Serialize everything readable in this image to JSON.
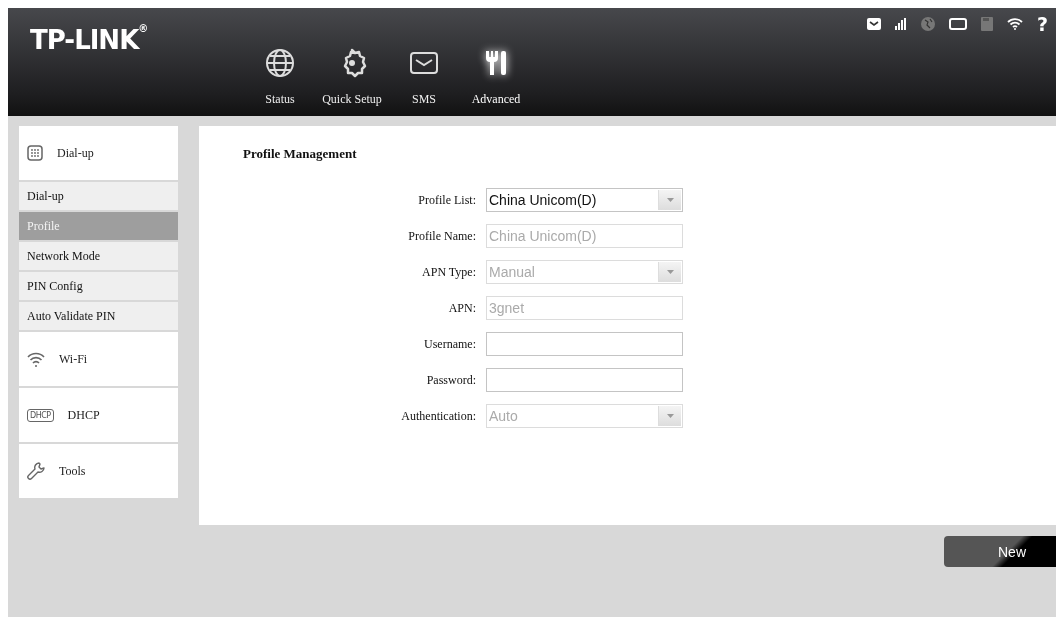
{
  "header": {
    "logo": "TP-LINK$^{®}$",
    "nav": [
      {
        "label": "Status",
        "selected": false
      },
      {
        "label": "Quick Setup",
        "selected": false
      },
      {
        "label": "SMS",
        "selected": false
      },
      {
        "label": "Advanced",
        "selected": true
      }
    ],
    "status_icons": [
      {
        "kind": "message",
        "active": true
      },
      {
        "kind": "signal",
        "active": true
      },
      {
        "kind": "globe",
        "active": false
      },
      {
        "kind": "battery",
        "active": true
      },
      {
        "kind": "sdcard",
        "active": false
      },
      {
        "kind": "wifi",
        "active": true
      },
      {
        "kind": "help",
        "text": "?",
        "active": true
      }
    ]
  },
  "sidebar": {
    "sections": [
      {
        "label": "Dial-up",
        "children": [
          {
            "label": "Dial-up",
            "selected": false
          },
          {
            "label": "Profile",
            "selected": true
          },
          {
            "label": "Network Mode",
            "selected": false
          },
          {
            "label": "PIN Config",
            "selected": false
          },
          {
            "label": "Auto Validate PIN",
            "selected": false
          }
        ]
      },
      {
        "label": "Wi-Fi"
      },
      {
        "label": "DHCP",
        "badge": "DHCP"
      },
      {
        "label": "Tools"
      }
    ]
  },
  "content": {
    "title": "Profile Management",
    "fields": [
      {
        "label": "Profile List:",
        "kind": "select",
        "value": "China Unicom(D)",
        "disabled": false
      },
      {
        "label": "Profile Name:",
        "kind": "text",
        "value": "China Unicom(D)",
        "disabled": true
      },
      {
        "label": "APN Type:",
        "kind": "select",
        "value": "Manual",
        "disabled": true
      },
      {
        "label": "APN:",
        "kind": "text",
        "value": "3gnet",
        "disabled": true
      },
      {
        "label": "Username:",
        "kind": "text",
        "disabled": false
      },
      {
        "label": "Password:",
        "kind": "password",
        "disabled": false
      },
      {
        "label": "Authentication:",
        "kind": "select",
        "value": "Auto",
        "disabled": true
      }
    ]
  },
  "buttons": [
    {
      "label": "New"
    }
  ]
}
